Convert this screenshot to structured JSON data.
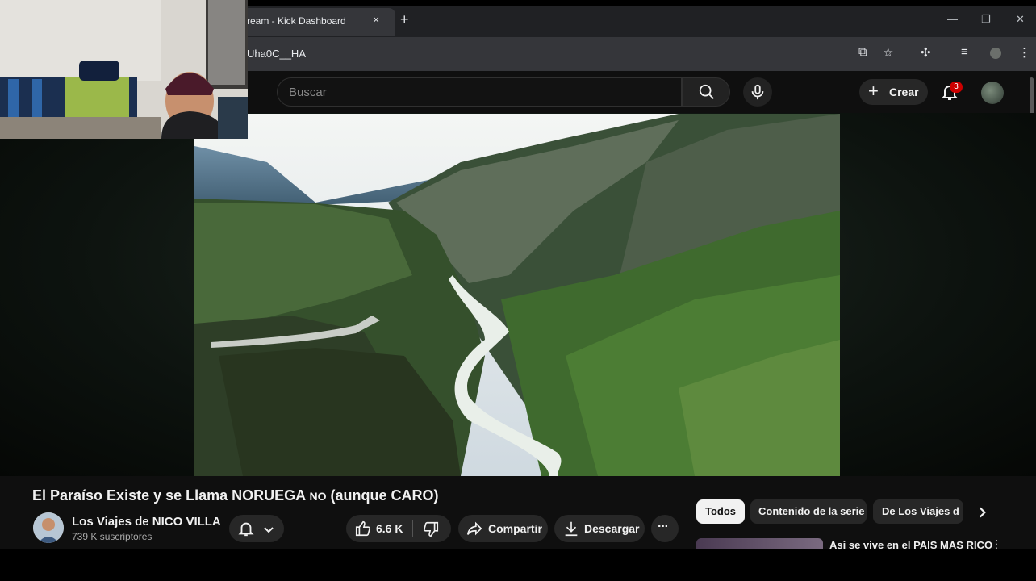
{
  "browser": {
    "tab_title": "ream - Kick Dashboard",
    "tab_close": "×",
    "new_tab": "+",
    "url": "Uha0C__HA"
  },
  "youtube": {
    "search_placeholder": "Buscar",
    "create_label": "Crear",
    "notifications_count": "3"
  },
  "video": {
    "title_part1": "El Paraíso Existe y se Llama NORUEGA",
    "title_small": "NO",
    "title_part2": "(aunque CARO)",
    "channel_name": "Los Viajes de NICO VILLA",
    "subscribers": "739 K suscriptores",
    "likes": "6.6 K",
    "share_label": "Compartir",
    "download_label": "Descargar",
    "more_label": "···"
  },
  "chips": [
    "Todos",
    "Contenido de la serie",
    "De Los Viajes de"
  ],
  "recommended": {
    "first_title": "Asi se vive en el PAIS MAS RICO"
  },
  "colors": {
    "accent_red": "#cc0000",
    "chip_active_bg": "#f1f1f1"
  }
}
